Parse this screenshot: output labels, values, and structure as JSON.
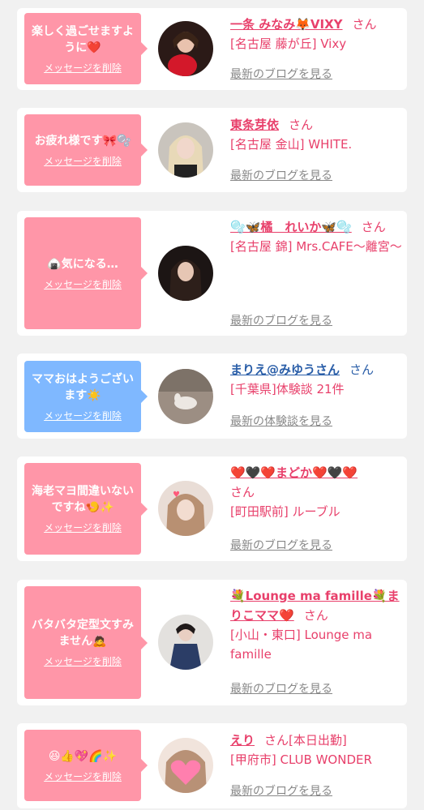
{
  "cards": [
    {
      "message": "楽しく過ごせますように❤️",
      "delete_label": "メッセージを削除",
      "name": "一条 みなみ🦊VIXY",
      "honorific": "さん",
      "shop": "[名古屋 藤が丘] Vixy",
      "link": "最新のブログを見る"
    },
    {
      "message": "お疲れ様です🎀🫧",
      "delete_label": "メッセージを削除",
      "name": "東条芽依",
      "honorific": "さん",
      "shop": "[名古屋 金山] WHITE.",
      "link": "最新のブログを見る"
    },
    {
      "message": "🍙気になる…",
      "delete_label": "メッセージを削除",
      "name": "🫧🦋橘　れいか🦋🫧",
      "honorific": "さん",
      "shop": "[名古屋 錦] Mrs.CAFE〜離宮〜",
      "link": "最新のブログを見る"
    },
    {
      "message": "ママおはようございます☀️",
      "delete_label": "メッセージを削除",
      "name": "まりえ@みゆうさん",
      "honorific": "さん",
      "shop": "[千葉県]体験談 21件",
      "link": "最新の体験談を見る"
    },
    {
      "message": "海老マヨ間違いないですね🍤✨",
      "delete_label": "メッセージを削除",
      "name": "❤️🖤❤️まどか❤️🖤❤️",
      "honorific": "さん",
      "shop": "[町田駅前] ルーブル",
      "link": "最新のブログを見る"
    },
    {
      "message": "バタバタ定型文すみません🙇",
      "delete_label": "メッセージを削除",
      "name": "💐Lounge ma famille💐まりこママ❤️",
      "honorific": "さん",
      "shop": "[小山・東口] Lounge ma famille",
      "link": "最新のブログを見る"
    },
    {
      "message": "😆👍💖🌈✨",
      "delete_label": "メッセージを削除",
      "name": "えり",
      "honorific": "さん[本日出勤]",
      "shop": "[甲府市] CLUB WONDER",
      "link": "最新のブログを見る"
    }
  ]
}
